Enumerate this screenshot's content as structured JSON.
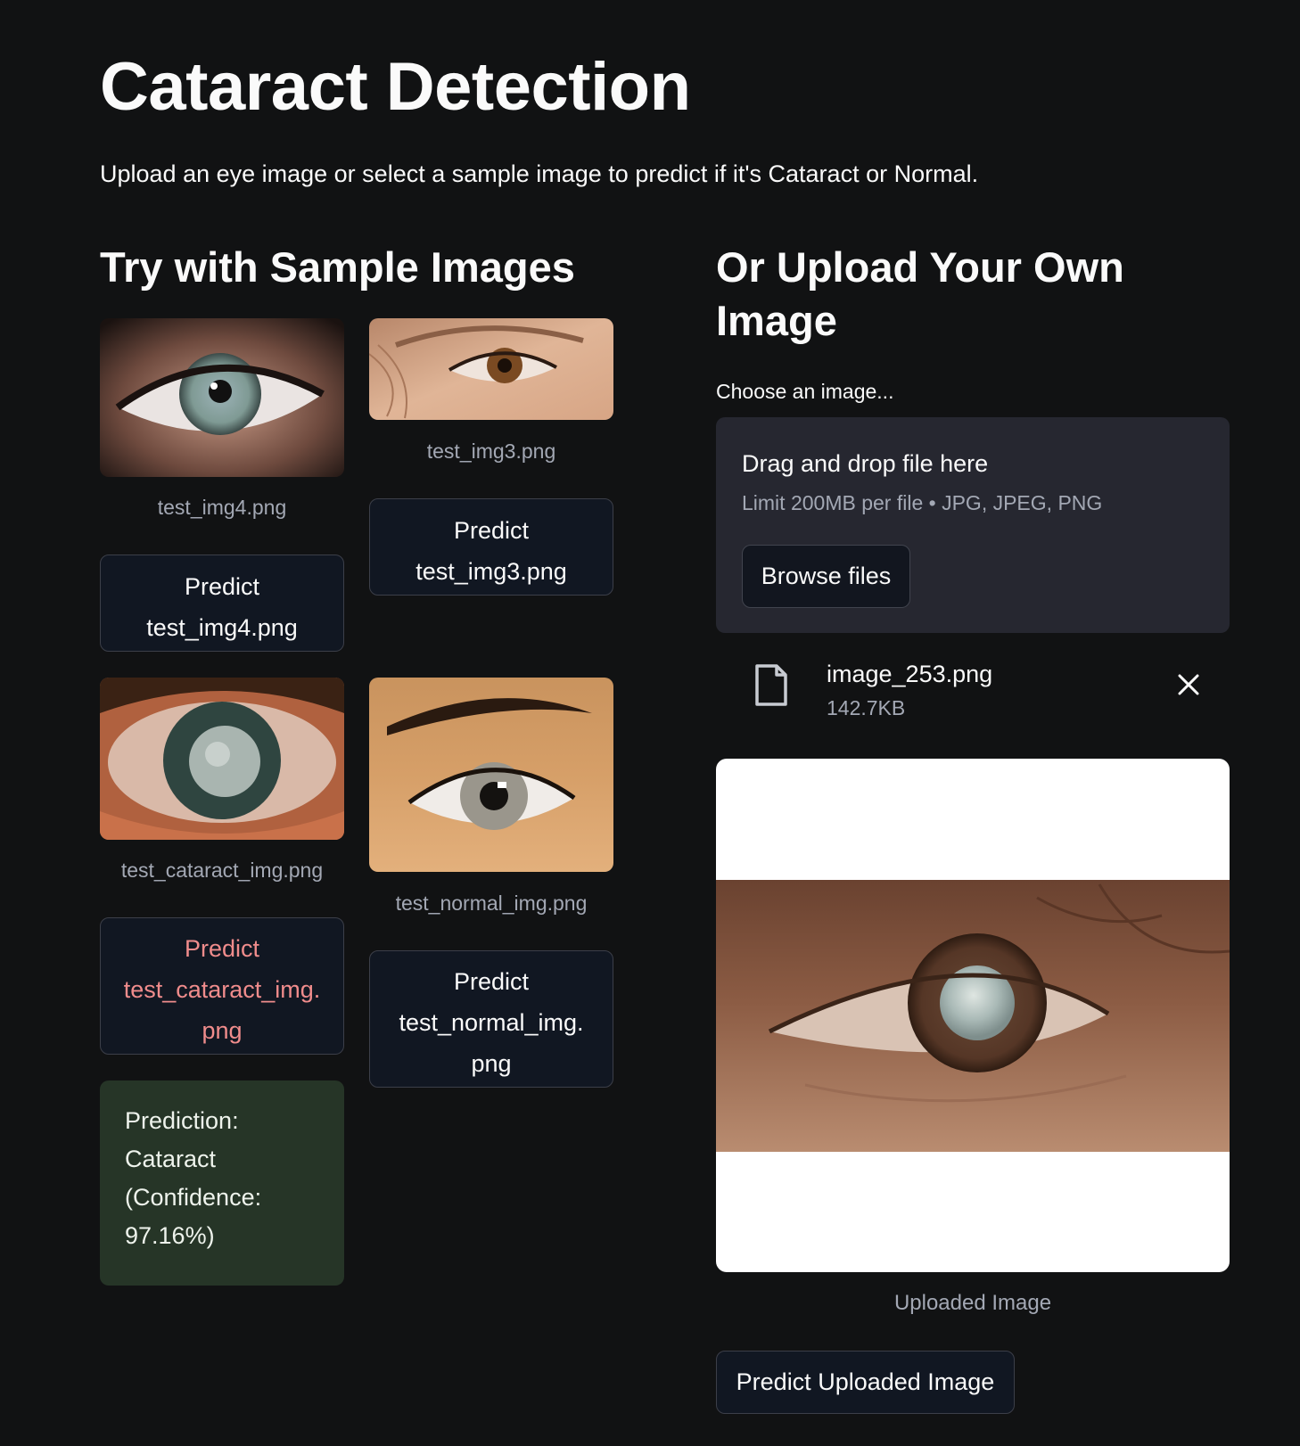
{
  "header": {
    "title": "Cataract Detection",
    "subtitle": "Upload an eye image or select a sample image to predict if it's Cataract or Normal."
  },
  "samples": {
    "heading": "Try with Sample Images",
    "items": [
      {
        "filename": "test_img4.png",
        "predict_line1": "Predict",
        "predict_line2": "test_img4.png",
        "predict_line3": ""
      },
      {
        "filename": "test_img3.png",
        "predict_line1": "Predict",
        "predict_line2": "test_img3.png",
        "predict_line3": ""
      },
      {
        "filename": "test_cataract_img.png",
        "predict_line1": "Predict",
        "predict_line2": "test_cataract_img.",
        "predict_line3": "png"
      },
      {
        "filename": "test_normal_img.png",
        "predict_line1": "Predict",
        "predict_line2": "test_normal_img.",
        "predict_line3": "png"
      }
    ],
    "result": {
      "line1": "Prediction:",
      "line2": "Cataract",
      "line3": "(Confidence:",
      "line4": "97.16%)"
    }
  },
  "upload": {
    "heading": "Or Upload Your Own Image",
    "label": "Choose an image...",
    "dropzone_title": "Drag and drop file here",
    "dropzone_limit": "Limit 200MB per file • JPG, JPEG, PNG",
    "browse_label": "Browse files",
    "file": {
      "name": "image_253.png",
      "size": "142.7KB"
    },
    "preview_caption": "Uploaded Image",
    "predict_label": "Predict Uploaded Image"
  },
  "icons": {
    "file": "file-icon",
    "close": "close-icon"
  },
  "colors": {
    "background": "#111213",
    "active_button_text": "#f08c8c",
    "success_bg": "#263527",
    "dropzone_bg": "#262730"
  }
}
